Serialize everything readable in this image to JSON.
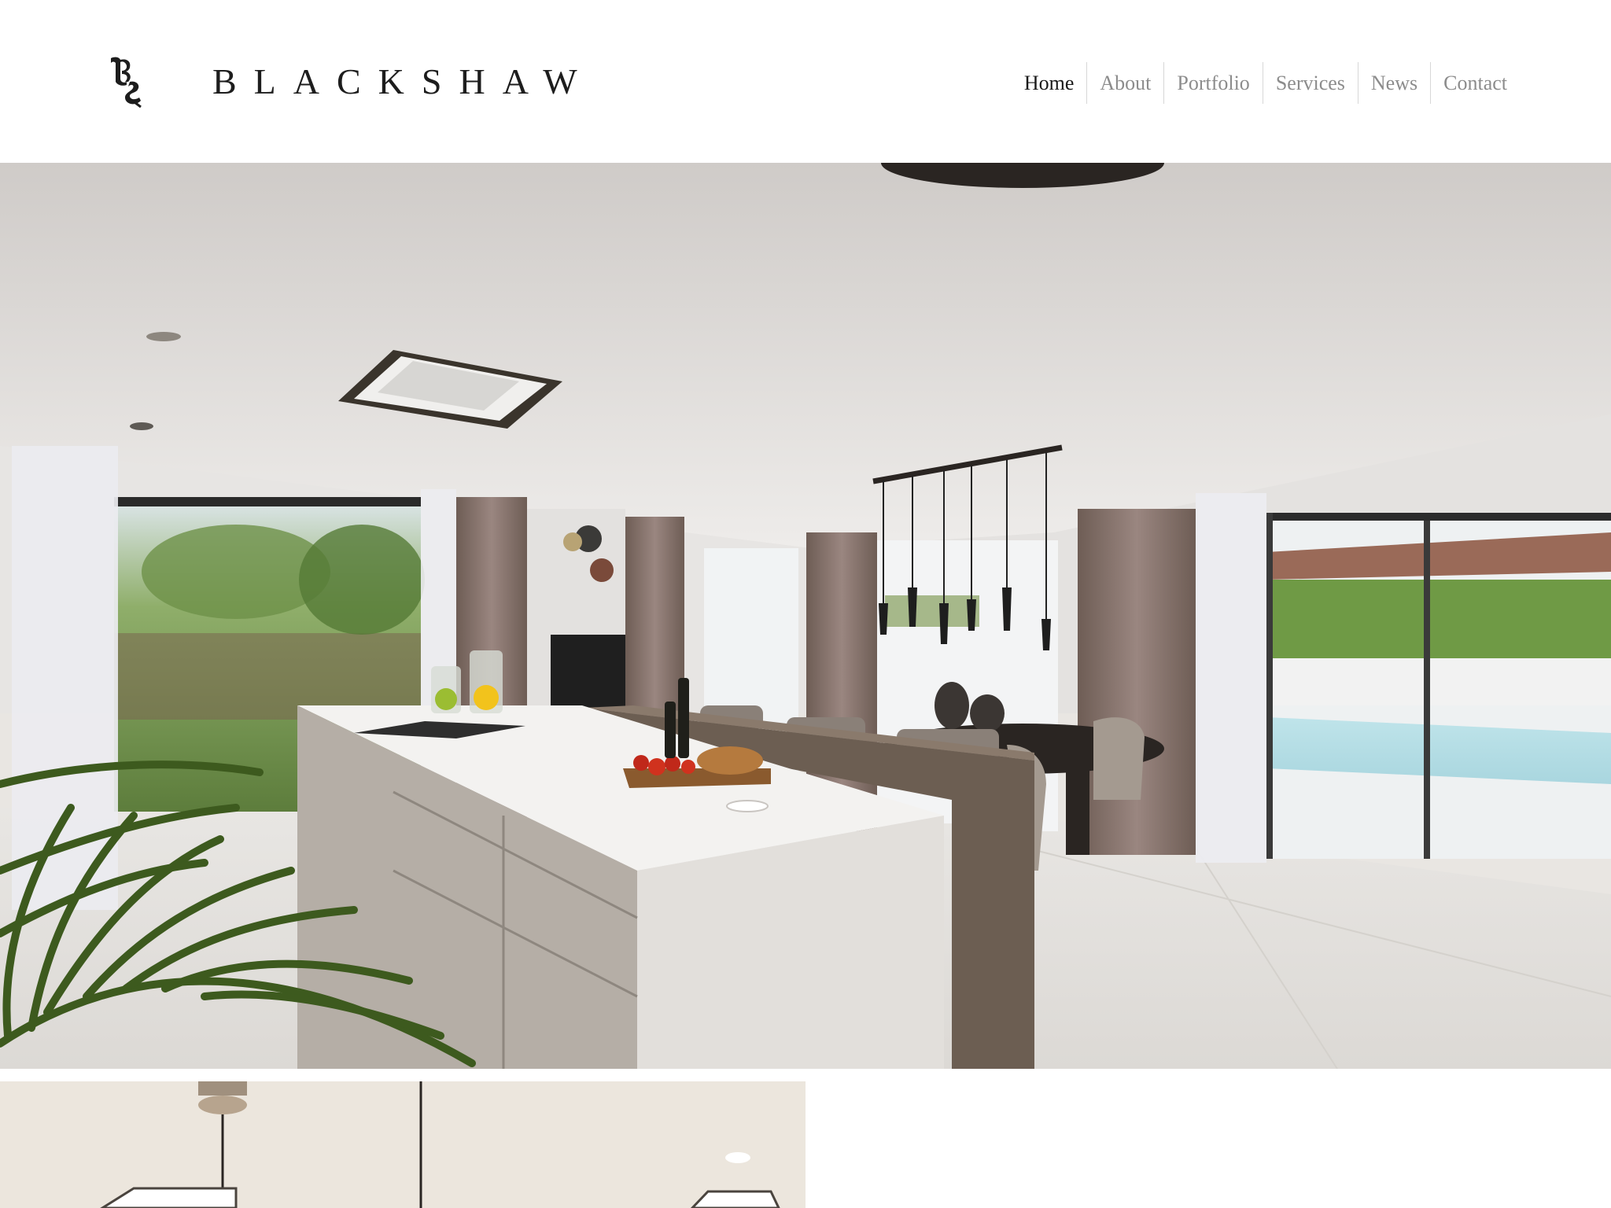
{
  "brand": {
    "monogram_icon": "bs-monogram-icon",
    "name": "BLACKSHAW"
  },
  "nav": {
    "items": [
      {
        "label": "Home",
        "active": true
      },
      {
        "label": "About",
        "active": false
      },
      {
        "label": "Portfolio",
        "active": false
      },
      {
        "label": "Services",
        "active": false
      },
      {
        "label": "News",
        "active": false
      },
      {
        "label": "Contact",
        "active": false
      }
    ]
  },
  "colors": {
    "background": "#ffffff",
    "nav_active": "#1a1a1a",
    "nav_inactive": "#8c8c8c",
    "divider": "#d7d7d7"
  }
}
